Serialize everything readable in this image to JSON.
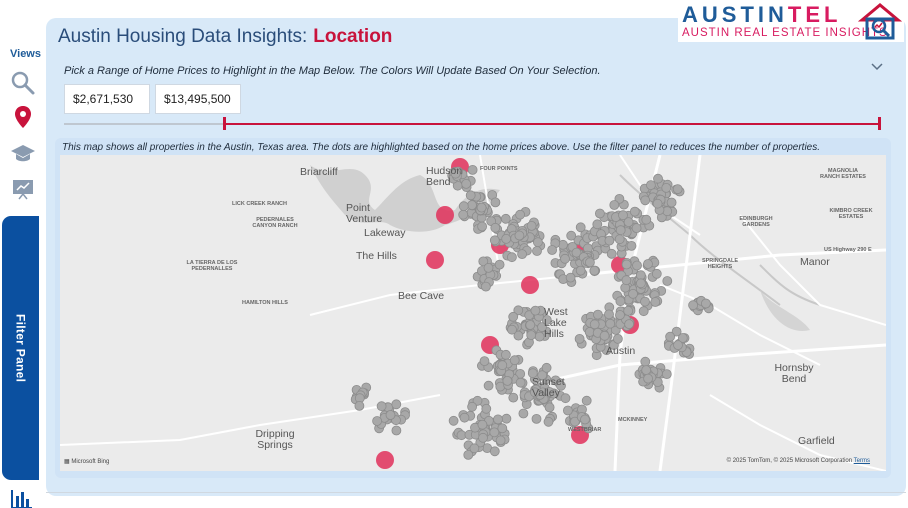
{
  "header": {
    "title": "Austin Housing Data Insights:",
    "page": "Location"
  },
  "logo": {
    "word_a": "AUSTIN",
    "word_b": "TEL",
    "subtitle": "AUSTIN REAL ESTATE INSIGHTS"
  },
  "sidebar": {
    "views_label": "Views",
    "filter_panel_label": "Filter Panel",
    "icons": [
      "search-icon",
      "location-pin-icon",
      "graduation-cap-icon",
      "presentation-icon",
      "bar-chart-icon"
    ]
  },
  "filter": {
    "instruction": "Pick a Range of Home Prices to Highlight in the Map Below. The Colors Will Update Based On Your Selection.",
    "min_price": "$2,671,530",
    "max_price": "$13,495,500"
  },
  "map": {
    "caption": "This map shows all properties in the Austin, Texas area. The dots are highlighted based on the home prices above. Use the filter panel to reduces the number of properties.",
    "attribution_left": "Microsoft Bing",
    "attribution_right": "© 2025 TomTom, © 2025 Microsoft Corporation",
    "terms": "Terms",
    "labels": [
      {
        "id": "briarcliff",
        "text": "Briarcliff"
      },
      {
        "id": "hudson-bend",
        "text": "Hudson Bend"
      },
      {
        "id": "point-venture",
        "text": "Point Venture"
      },
      {
        "id": "lakeway",
        "text": "Lakeway"
      },
      {
        "id": "the-hills",
        "text": "The Hills"
      },
      {
        "id": "bee-cave",
        "text": "Bee Cave"
      },
      {
        "id": "west-lake-hills",
        "text": "West Lake Hills"
      },
      {
        "id": "austin",
        "text": "Austin"
      },
      {
        "id": "manor",
        "text": "Manor"
      },
      {
        "id": "hornsby-bend",
        "text": "Hornsby Bend"
      },
      {
        "id": "garfield",
        "text": "Garfield"
      },
      {
        "id": "dripping-springs",
        "text": "Dripping Springs"
      },
      {
        "id": "sunset-valley",
        "text": "Sunset Valley"
      },
      {
        "id": "lick-creek-ranch",
        "text": "LICK CREEK RANCH"
      },
      {
        "id": "pedernales-canyon-ranch",
        "text": "PEDERNALES CANYON RANCH"
      },
      {
        "id": "la-tierra",
        "text": "LA TIERRA DE LOS PEDERNALLES"
      },
      {
        "id": "hamilton-hills",
        "text": "HAMILTON HILLS"
      },
      {
        "id": "magnolia",
        "text": "MAGNOLIA RANCH ESTATES"
      },
      {
        "id": "kimbro",
        "text": "KIMBRO CREEK ESTATES"
      },
      {
        "id": "edinburgh",
        "text": "EDINBURGH GARDENS"
      },
      {
        "id": "springdale",
        "text": "SPRINGDALE HEIGHTS"
      },
      {
        "id": "mckinney",
        "text": "MCKINNEY"
      },
      {
        "id": "westbriar",
        "text": "WESTBRIAR"
      },
      {
        "id": "four-points",
        "text": "FOUR POINTS"
      },
      {
        "id": "us290e",
        "text": "US Highway 290 E"
      }
    ]
  },
  "colors": {
    "accent": "#c8133c",
    "brand_blue": "#1f5c99",
    "panel_bg": "#d8e9f8",
    "dot_gray": "#a8a8a8",
    "dot_highlight": "#e0305a"
  }
}
